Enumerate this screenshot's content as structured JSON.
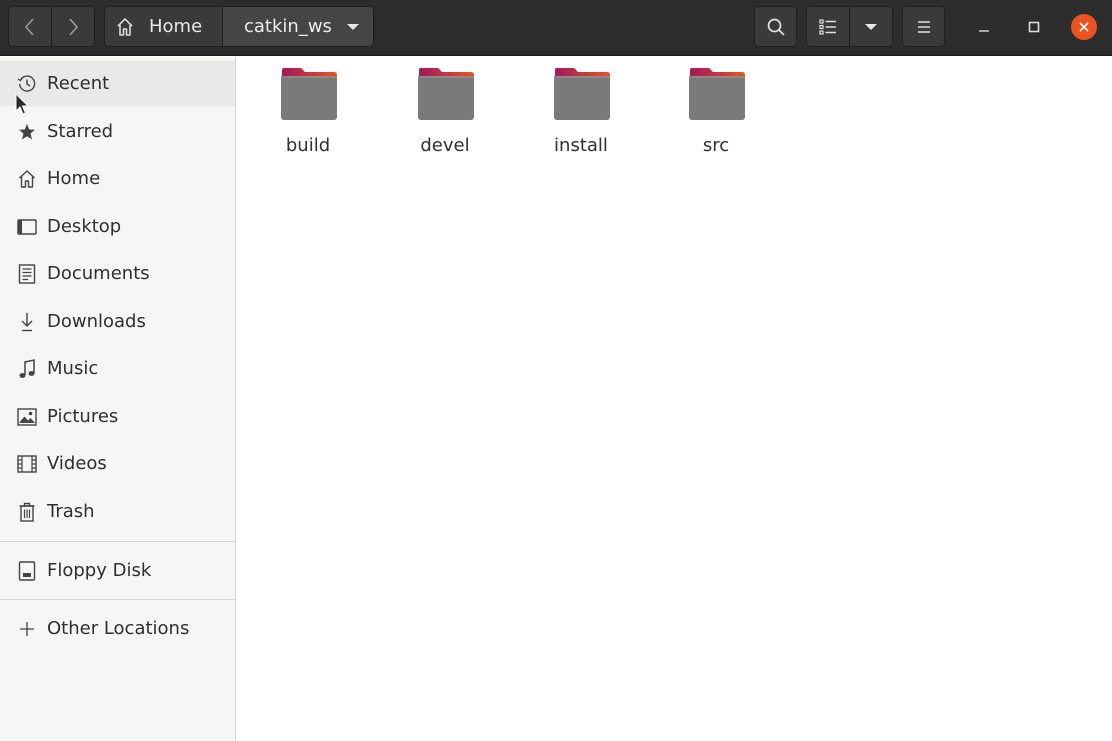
{
  "header": {
    "path": {
      "home_label": "Home",
      "current_label": "catkin_ws"
    },
    "icons": {
      "back": "chevron-left-icon",
      "forward": "chevron-right-icon",
      "home": "home-icon",
      "search": "search-icon",
      "list_view": "list-view-icon",
      "view_options": "caret-down-icon",
      "menu": "hamburger-menu-icon"
    },
    "window_controls": [
      "minimize",
      "maximize",
      "close"
    ],
    "accent_color": "#e95420"
  },
  "sidebar": {
    "items": [
      {
        "label": "Recent",
        "icon": "clock-icon",
        "selected": true
      },
      {
        "label": "Starred",
        "icon": "star-icon"
      },
      {
        "label": "Home",
        "icon": "home-icon"
      },
      {
        "label": "Desktop",
        "icon": "desktop-icon"
      },
      {
        "label": "Documents",
        "icon": "document-icon"
      },
      {
        "label": "Downloads",
        "icon": "download-icon"
      },
      {
        "label": "Music",
        "icon": "music-icon"
      },
      {
        "label": "Pictures",
        "icon": "picture-icon"
      },
      {
        "label": "Videos",
        "icon": "video-icon"
      },
      {
        "label": "Trash",
        "icon": "trash-icon"
      }
    ],
    "devices": [
      {
        "label": "Floppy Disk",
        "icon": "floppy-disk-icon"
      }
    ],
    "other": [
      {
        "label": "Other Locations",
        "icon": "plus-icon"
      }
    ]
  },
  "files": [
    {
      "name": "build",
      "type": "folder"
    },
    {
      "name": "devel",
      "type": "folder"
    },
    {
      "name": "install",
      "type": "folder"
    },
    {
      "name": "src",
      "type": "folder"
    }
  ],
  "colors": {
    "folder_body": "#7a7a7a",
    "folder_tab_start": "#a2195b",
    "folder_tab_end": "#e95420"
  }
}
